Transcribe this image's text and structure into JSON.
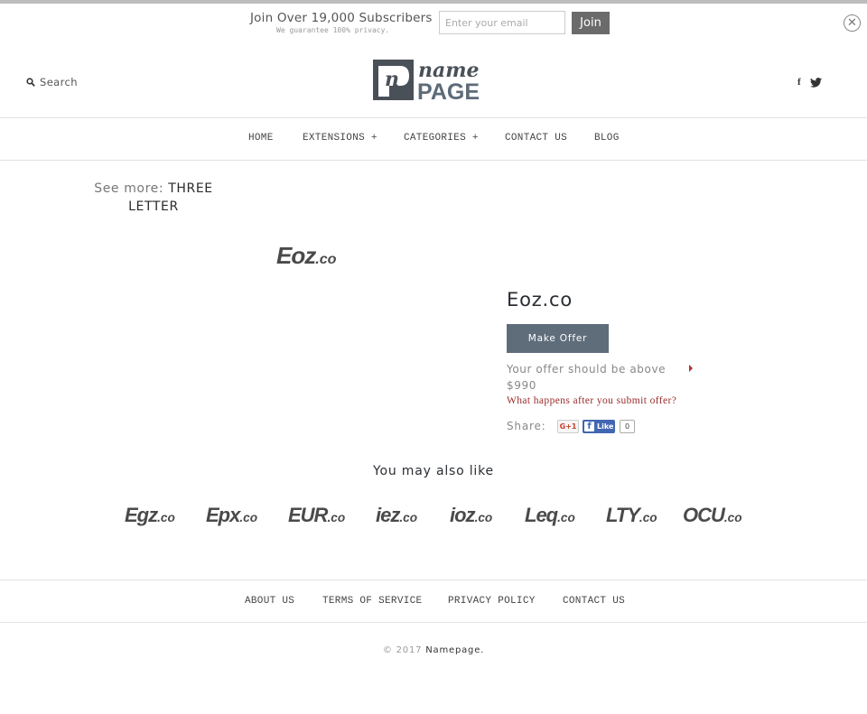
{
  "subscribe": {
    "title": "Join Over 19,000 Subscribers",
    "note": "We guarantee 100% privacy.",
    "email_placeholder": "Enter your email",
    "email_value": "",
    "join_label": "Join",
    "close_icon": "close-circle-icon"
  },
  "header": {
    "search_label": "Search",
    "search_icon": "search-icon",
    "logo": {
      "top_text": "name",
      "bottom_text": "PAGE",
      "mark_letter": "n"
    },
    "social": [
      {
        "name": "facebook",
        "glyph": "f"
      },
      {
        "name": "twitter",
        "glyph": "twitter-bird"
      }
    ]
  },
  "nav": {
    "items": [
      {
        "label": "HOME"
      },
      {
        "label": "EXTENSIONS +"
      },
      {
        "label": "CATEGORIES +"
      },
      {
        "label": "CONTACT US"
      },
      {
        "label": "BLOG"
      }
    ]
  },
  "see_more": {
    "label": "See more:",
    "link": "THREE LETTER"
  },
  "product": {
    "logo_name": "Eoz",
    "logo_tld": ".co",
    "title": "Eoz.co",
    "offer_button": "Make Offer",
    "offer_note": "Your offer should be above $990",
    "min_offer": "$990",
    "what_happens_link": "What happens after you submit offer?",
    "share_label": "Share:",
    "gplus_label": "G+1",
    "fb_like_label": "Like",
    "fb_like_count": "0"
  },
  "related": {
    "title": "You may also like",
    "items": [
      {
        "name": "Egz",
        "tld": ".co"
      },
      {
        "name": "Epx",
        "tld": ".co"
      },
      {
        "name": "EUR",
        "tld": ".co"
      },
      {
        "name": "iez",
        "tld": ".co"
      },
      {
        "name": "ioz",
        "tld": ".co"
      },
      {
        "name": "Leq",
        "tld": ".co"
      },
      {
        "name": "LTY",
        "tld": ".co"
      },
      {
        "name": "OCU",
        "tld": ".co"
      }
    ]
  },
  "footer": {
    "links": [
      {
        "label": "ABOUT US"
      },
      {
        "label": "TERMS OF SERVICE"
      },
      {
        "label": "PRIVACY POLICY"
      },
      {
        "label": "CONTACT US"
      }
    ],
    "copyright_prefix": "© 2017",
    "copyright_name": "Namepage."
  },
  "colors": {
    "button_dark": "#5f6d7b",
    "join_button": "#6b6b6b",
    "link_red": "#9b2a2a",
    "facebook_blue": "#4267b2",
    "gplus_red": "#c8412b"
  }
}
